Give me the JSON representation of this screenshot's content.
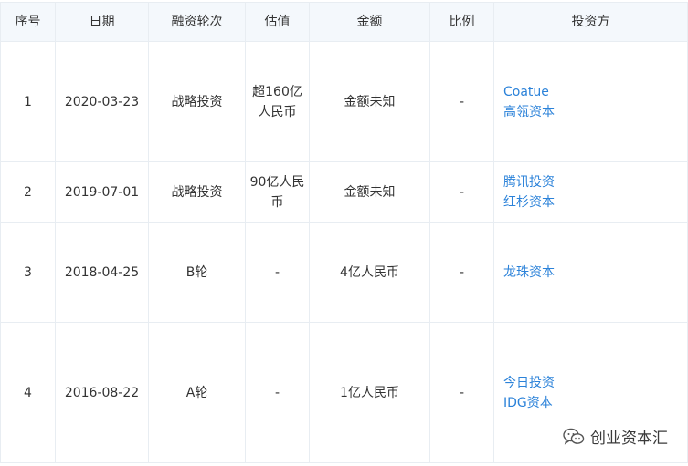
{
  "table": {
    "headers": {
      "index": "序号",
      "date": "日期",
      "round": "融资轮次",
      "valuation": "估值",
      "amount": "金额",
      "ratio": "比例",
      "investors": "投资方"
    },
    "rows": [
      {
        "index": "1",
        "date": "2020-03-23",
        "round": "战略投资",
        "valuation": "超160亿人民币",
        "amount": "金额未知",
        "ratio": "-",
        "investors": [
          "Coatue",
          "高瓴资本"
        ]
      },
      {
        "index": "2",
        "date": "2019-07-01",
        "round": "战略投资",
        "valuation": "90亿人民币",
        "amount": "金额未知",
        "ratio": "-",
        "investors": [
          "腾讯投资",
          "红杉资本"
        ]
      },
      {
        "index": "3",
        "date": "2018-04-25",
        "round": "B轮",
        "valuation": "-",
        "amount": "4亿人民币",
        "ratio": "-",
        "investors": [
          "龙珠资本"
        ]
      },
      {
        "index": "4",
        "date": "2016-08-22",
        "round": "A轮",
        "valuation": "-",
        "amount": "1亿人民币",
        "ratio": "-",
        "investors": [
          "今日投资",
          "IDG资本"
        ]
      }
    ]
  },
  "watermark": {
    "icon": "wechat-icon",
    "text": "创业资本汇"
  },
  "colors": {
    "link": "#2b82d9",
    "header_bg": "#f4f8fc",
    "border": "#e8edf2"
  }
}
